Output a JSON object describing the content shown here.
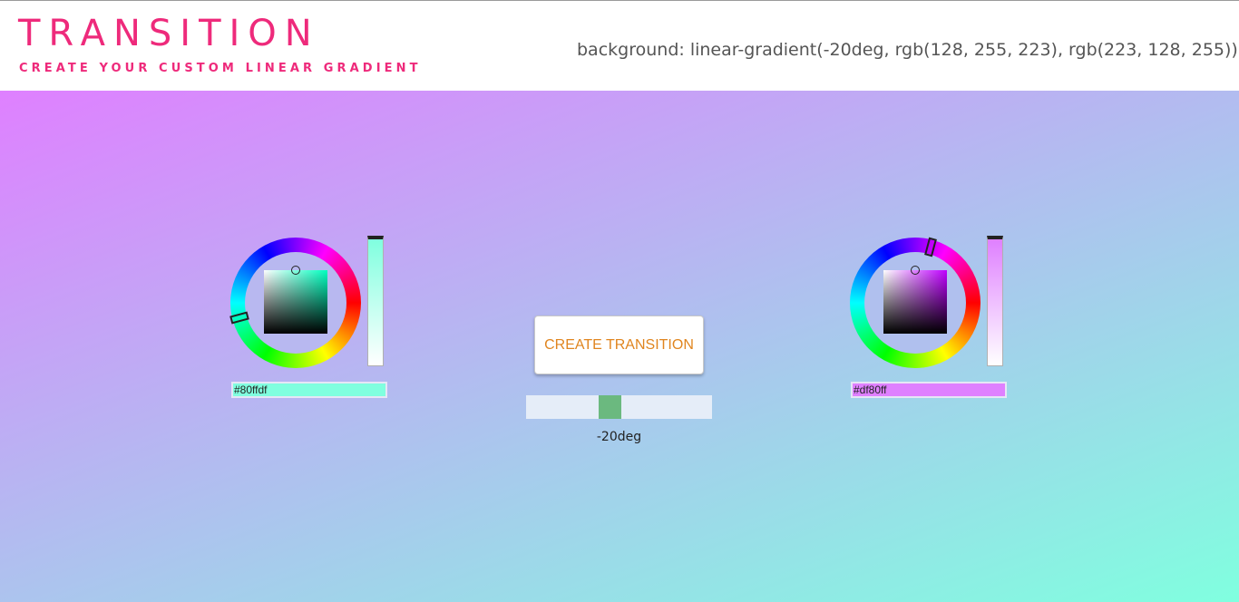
{
  "header": {
    "logo": "TRANSITION",
    "subtitle": "CREATE YOUR CUSTOM LINEAR GRADIENT",
    "css_output": "background: linear-gradient(-20deg, rgb(128, 255, 223), rgb(223, 128, 255));"
  },
  "gradient": {
    "angle_label": "-20deg",
    "angle_value": -20,
    "angle_min": -180,
    "angle_max": 180,
    "start_color": "#80ffdf",
    "end_color": "#df80ff"
  },
  "picker_left": {
    "hex_value": "#80ffdf",
    "hue_color": "#00ffbf",
    "saturation": 0.5,
    "value": 1.0
  },
  "picker_right": {
    "hex_value": "#df80ff",
    "hue_color": "#bf00ff",
    "saturation": 0.5,
    "value": 1.0
  },
  "controls": {
    "create_button_label": "CREATE TRANSITION",
    "accent_color": "#ee2a7b",
    "button_text_color": "#e0851f",
    "slider_thumb_color": "#6bb97f"
  }
}
